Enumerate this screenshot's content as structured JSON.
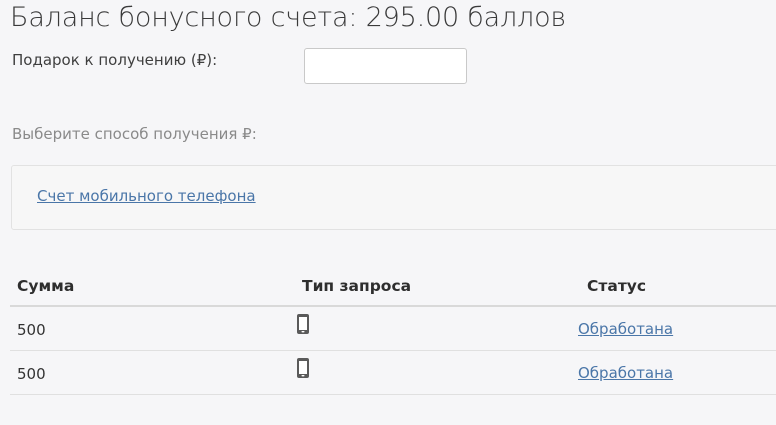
{
  "balance": {
    "title": "Баланс бонусного счета: 295.00 баллов"
  },
  "gift": {
    "label": "Подарок к получению (₽):",
    "value": ""
  },
  "method": {
    "label": "Выберите способ получения ₽:",
    "option_label": "Счет мобильного телефона"
  },
  "history": {
    "columns": [
      "Сумма",
      "Тип запроса",
      "Статус"
    ],
    "rows": [
      {
        "sum": "500",
        "type_icon": "mobile-phone-icon",
        "status": "Обработана"
      },
      {
        "sum": "500",
        "type_icon": "mobile-phone-icon",
        "status": "Обработана"
      }
    ]
  },
  "colors": {
    "link": "#4a76a8",
    "background": "#f6f6f8"
  }
}
